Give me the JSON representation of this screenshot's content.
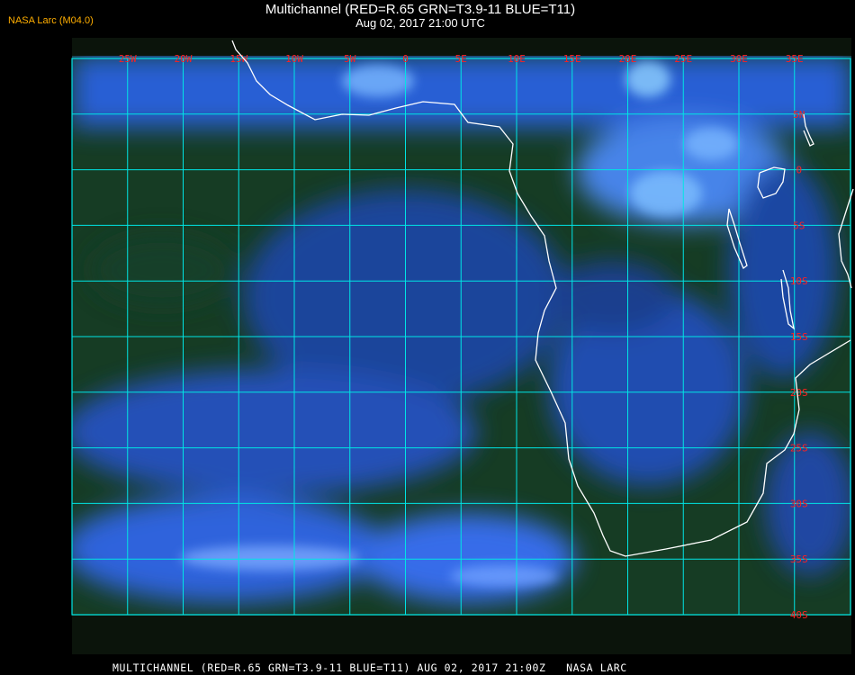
{
  "header": {
    "title": "Multichannel (RED=R.65 GRN=T3.9-11 BLUE=T11)",
    "datetime": "Aug 02, 2017 21:00 UTC",
    "source_label": "NASA Larc (M04.0)"
  },
  "map": {
    "longitude_labels": [
      "25W",
      "20W",
      "15W",
      "10W",
      "5W",
      "0",
      "5E",
      "10E",
      "15E",
      "20E",
      "25E",
      "30E",
      "35E"
    ],
    "latitude_labels": [
      "5N",
      "0",
      "5S",
      "10S",
      "15S",
      "20S",
      "25S",
      "30S",
      "35S",
      "40S"
    ],
    "colors": {
      "grid": "#00e5e5",
      "labels": "#ff2020",
      "coastline": "#ffffff",
      "land": "#123a12",
      "cloud": "#2a5cff"
    }
  },
  "footer": {
    "caption": "MULTICHANNEL (RED=R.65 GRN=T3.9-11 BLUE=T11) AUG 02, 2017 21:00Z   NASA LARC"
  }
}
